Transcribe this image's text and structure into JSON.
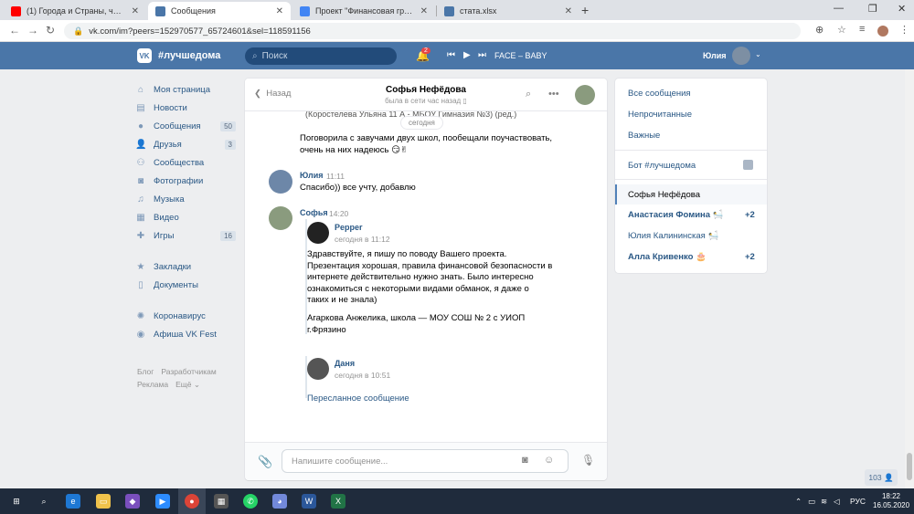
{
  "browser": {
    "tabs": [
      {
        "title": "(1) Города и Страны, часть 1 - Ю",
        "favicon_color": "#ff0000",
        "active": false
      },
      {
        "title": "Сообщения",
        "favicon_color": "#4a76a8",
        "active": true
      },
      {
        "title": "Проект \"Финансовая грамотно",
        "favicon_color": "#4285f4",
        "active": false
      },
      {
        "title": "стата.xlsx",
        "favicon_color": "#4a76a8",
        "active": false
      }
    ],
    "url": "vk.com/im?peers=152970577_65724601&sel=118591156"
  },
  "vk_header": {
    "logo": "VK",
    "brand": "#лучшедома",
    "search_placeholder": "Поиск",
    "notifications_count": "2",
    "track": "FACE – BABY",
    "user_name": "Юлия"
  },
  "left_menu": {
    "items": [
      {
        "label": "Моя страница",
        "icon": "home-icon",
        "count": ""
      },
      {
        "label": "Новости",
        "icon": "news-icon",
        "count": ""
      },
      {
        "label": "Сообщения",
        "icon": "messages-icon",
        "count": "50"
      },
      {
        "label": "Друзья",
        "icon": "friends-icon",
        "count": "3"
      },
      {
        "label": "Сообщества",
        "icon": "communities-icon",
        "count": ""
      },
      {
        "label": "Фотографии",
        "icon": "camera-icon",
        "count": ""
      },
      {
        "label": "Музыка",
        "icon": "music-icon",
        "count": ""
      },
      {
        "label": "Видео",
        "icon": "video-icon",
        "count": ""
      },
      {
        "label": "Игры",
        "icon": "games-icon",
        "count": "16"
      }
    ],
    "items2": [
      {
        "label": "Закладки",
        "icon": "star-icon"
      },
      {
        "label": "Документы",
        "icon": "document-icon"
      }
    ],
    "items3": [
      {
        "label": "Коронавирус",
        "icon": "virus-icon"
      },
      {
        "label": "Афиша VK Fest",
        "icon": "fest-icon"
      }
    ],
    "footer": [
      "Блог",
      "Разработчикам",
      "Реклама",
      "Ещё ⌄"
    ]
  },
  "chat": {
    "back_label": "Назад",
    "name": "Софья Нефёдова",
    "status": "была в сети час назад",
    "date_divider": "сегодня",
    "cut_text": "(Коростелева Ульяна 11 А - МБОУ Гимназия №3) (ред.)",
    "msg1_line1": "Поговорила с завучами двух школ, пообещали поучаствовать,",
    "msg1_line2": "очень на них надеюсь 😏✌",
    "msg2_author": "Юлия",
    "msg2_time": "11:11",
    "msg2_text": "Спасибо)) все учту, добавлю",
    "msg3_author": "Софья",
    "msg3_time": "14:20",
    "fwd1_author": "Pepper",
    "fwd1_time": "сегодня в 11:12",
    "fwd1_lines": [
      "Здравствуйте, я пишу по поводу Вашего проекта.",
      "Презентация хорошая, правила финансовой безопасности в",
      "интернете действительно нужно знать. Было интересно",
      "ознакомиться с некоторыми видами обманок, я даже о",
      "таких и не знала)"
    ],
    "fwd1_sign1": "Агаркова Анжелика, школа — МОУ СОШ № 2 с УИОП",
    "fwd1_sign2": "г.Фрязино",
    "fwd2_author": "Даня",
    "fwd2_time": "сегодня в 10:51",
    "fwd2_link": "Пересланное сообщение",
    "composer_placeholder": "Напишите сообщение..."
  },
  "right_panel": {
    "all": "Все сообщения",
    "unread": "Непрочитанные",
    "important": "Важные",
    "bot": "Бот #лучшедома",
    "selected": "Софья Нефёдова",
    "c1": "Анастасия Фомина 🛀",
    "c1_count": "+2",
    "c2": "Юлия Калининская 🛀",
    "c3": "Алла Кривенко 🎂",
    "c3_count": "+2"
  },
  "online_counter": "103",
  "taskbar": {
    "lang": "РУС",
    "time": "18:22",
    "date": "16.05.2020"
  },
  "colors": {
    "vk_blue": "#4a76a8",
    "link_blue": "#2a5885",
    "taskbar": "#1f2b3c"
  }
}
